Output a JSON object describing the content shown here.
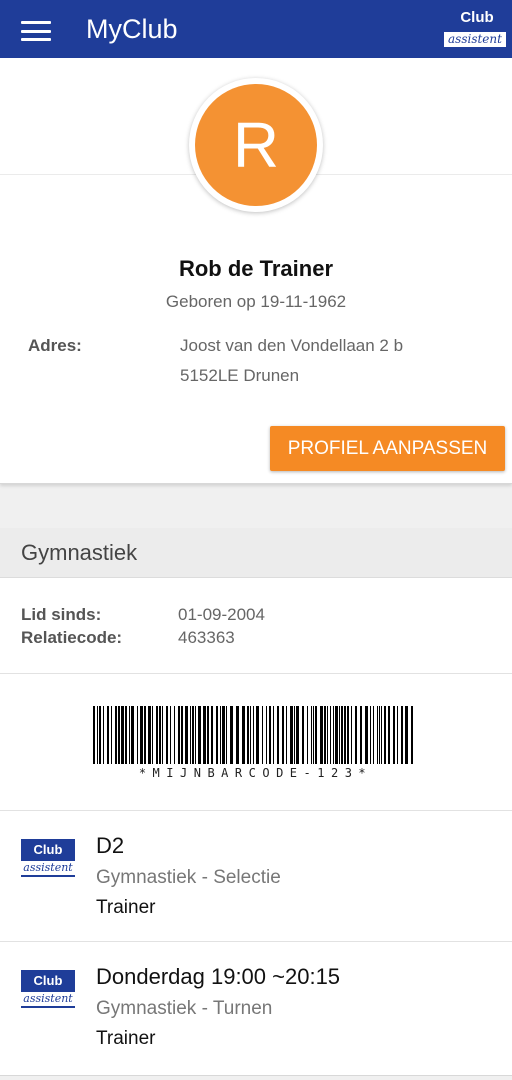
{
  "appbar": {
    "title": "MyClub",
    "brand_top": "Club",
    "brand_bottom": "assistent"
  },
  "profile": {
    "avatar_letter": "R",
    "name": "Rob de Trainer",
    "born": "Geboren op 19-11-1962",
    "address_label": "Adres:",
    "address_line1": "Joost van den Vondellaan 2 b",
    "address_line2": "5152LE Drunen",
    "edit_button": "PROFIEL AANPASSEN"
  },
  "club": {
    "name": "Gymnastiek",
    "member_since_label": "Lid sinds:",
    "member_since": "01-09-2004",
    "relation_label": "Relatiecode:",
    "relation_code": "463363",
    "barcode_text": "*MIJNBARCODE-123*"
  },
  "groups": [
    {
      "logo_top": "Club",
      "logo_bottom": "assistent",
      "title": "D2",
      "subtitle": "Gymnastiek - Selectie",
      "role": "Trainer"
    },
    {
      "logo_top": "Club",
      "logo_bottom": "assistent",
      "title": "Donderdag 19:00 ~20:15",
      "subtitle": "Gymnastiek - Turnen",
      "role": "Trainer"
    }
  ],
  "colors": {
    "appbar": "#1f3d99",
    "accent": "#f58a24",
    "avatar": "#f49233"
  }
}
